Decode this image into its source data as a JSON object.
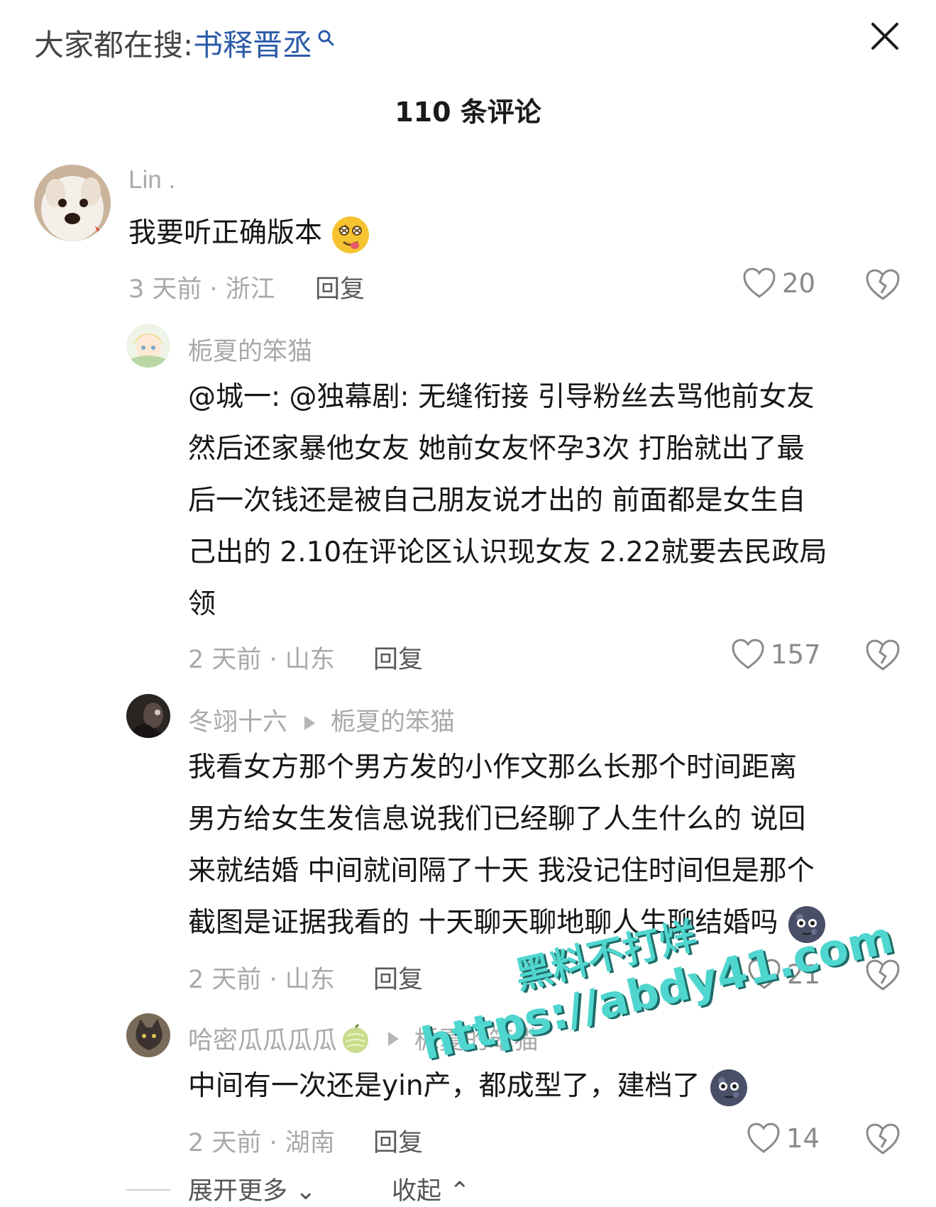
{
  "header": {
    "search_prefix": "大家都在搜:",
    "search_keyword": "书释晋丞",
    "comment_count": "110 条评论"
  },
  "comments": [
    {
      "username": "Lin .",
      "text": "我要听正确版本",
      "emoji": "drooling-face-emoji",
      "time_location": "3 天前 · 浙江",
      "reply_label": "回复",
      "likes": "20"
    },
    {
      "username": "栀夏的笨猫",
      "text_lines": [
        "@城一: @独幕剧: 无缝衔接 引导粉丝去骂他前女友",
        "然后还家暴他女友 她前女友怀孕3次 打胎就出了最",
        "后一次钱还是被自己朋友说才出的 前面都是女生自",
        "己出的 2.10在评论区认识现女友 2.22就要去民政局",
        "领"
      ],
      "time_location": "2 天前 · 山东",
      "reply_label": "回复",
      "likes": "157"
    },
    {
      "username": "冬翊十六",
      "reply_to": "栀夏的笨猫",
      "text_lines": [
        "我看女方那个男方发的小作文那么长那个时间距离",
        "男方给女生发信息说我们已经聊了人生什么的 说回",
        "来就结婚 中间就间隔了十天 我没记住时间但是那个",
        "截图是证据我看的 十天聊天聊地聊人生聊结婚吗"
      ],
      "emoji": "new-moon-face-emoji",
      "time_location": "2 天前 · 山东",
      "reply_label": "回复",
      "likes": "21"
    },
    {
      "username": "哈密瓜瓜瓜瓜",
      "reply_to": "栀夏的笨猫",
      "text": "中间有一次还是yin产，都成型了，建档了",
      "emoji": "new-moon-face-emoji",
      "time_location": "2 天前 · 湖南",
      "reply_label": "回复",
      "likes": "14"
    }
  ],
  "footer": {
    "expand_more": "展开更多",
    "collapse": "收起"
  },
  "watermark": {
    "line1": "黑料不打烊",
    "line2": "https://abdy41.com"
  },
  "colors": {
    "keyword_blue": "#2b5aa8",
    "meta_gray": "#a9a9a9",
    "watermark_teal": "#4fd6cf"
  }
}
